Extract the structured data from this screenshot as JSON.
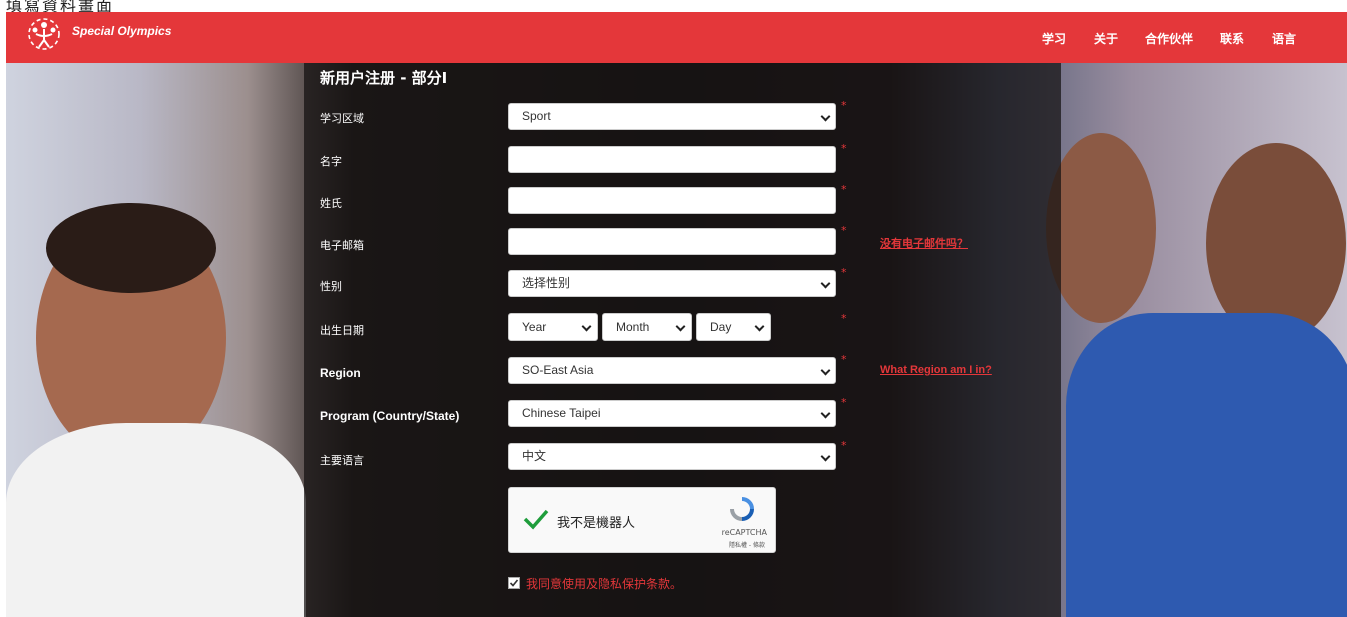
{
  "caption": "填寫資料畫面",
  "header": {
    "brand": "Special Olympics",
    "nav": [
      "学习",
      "关于",
      "合作伙伴",
      "联系",
      "语言"
    ]
  },
  "form": {
    "title": "新用户注册 - 部分I",
    "fields": [
      {
        "label": "学习区域",
        "value": "Sport"
      },
      {
        "label": "名字",
        "value": ""
      },
      {
        "label": "姓氏",
        "value": ""
      },
      {
        "label": "电子邮箱",
        "value": ""
      },
      {
        "label": "性别",
        "value": "选择性别"
      },
      {
        "label": "出生日期",
        "year": "Year",
        "month": "Month",
        "day": "Day"
      },
      {
        "label": "Region",
        "value": "SO-East Asia"
      },
      {
        "label": "Program (Country/State)",
        "value": "Chinese Taipei"
      },
      {
        "label": "主要语言",
        "value": "中文"
      }
    ],
    "links": {
      "no_email": "没有电子邮件吗？",
      "region_help": "What Region am I in?"
    },
    "captcha": {
      "label": "我不是機器人",
      "brand": "reCAPTCHA",
      "terms": "隱私權 - 條款"
    },
    "agree_text": "我同意使用及隐私保护条款。",
    "required_mark": "*"
  },
  "colors": {
    "brand_red": "#e4373a"
  }
}
